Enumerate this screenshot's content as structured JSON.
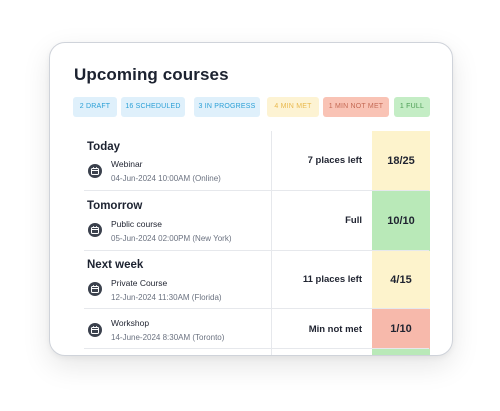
{
  "title": "Upcoming courses",
  "badges": {
    "draft": "2 DRAFT",
    "scheduled": "16 SCHEDULED",
    "in_progress": "3 IN PROGRESS",
    "min_met": "4 MIN MET",
    "min_not_met": "1 MIN NOT MET",
    "full": "1 FULL"
  },
  "colors": {
    "info_bg": "#dff0fb",
    "info_text": "#2a9fd6",
    "warn_bg": "#fdf3d3",
    "warn_text": "#e9b94e",
    "danger_bg": "#f9c3b5",
    "danger_text": "#c56a55",
    "success_bg": "#c4edc5",
    "success_text": "#4a9c52"
  },
  "rows": [
    {
      "group": "Today",
      "type": "Webinar",
      "date": "04-Jun-2024 10:00AM (Online)",
      "places": "7 places left",
      "count": "18/25",
      "icon": "calendar-icon"
    },
    {
      "group": "Tomorrow",
      "type": "Public course",
      "date": "05-Jun-2024 02:00PM (New York)",
      "places": "Full",
      "count": "10/10",
      "icon": "calendar-icon"
    },
    {
      "group": "Next week",
      "type": "Private Course",
      "date": "12-Jun-2024 11:30AM (Florida)",
      "places": "11 places left",
      "count": "4/15",
      "icon": "calendar-icon"
    },
    {
      "group": "",
      "type": "Workshop",
      "date": "14-June-2024 8:30AM (Toronto)",
      "places": "Min not met",
      "count": "1/10",
      "icon": "calendar-icon"
    }
  ]
}
